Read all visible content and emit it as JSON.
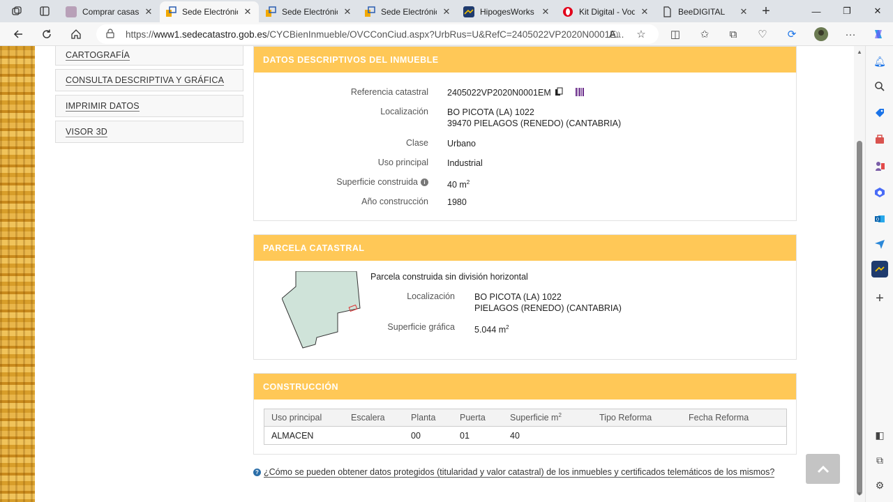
{
  "browser": {
    "tabs": [
      {
        "title": "Comprar casas e",
        "favicon": "idealista-icon"
      },
      {
        "title": "Sede Electrónica",
        "favicon": "catastro-icon"
      },
      {
        "title": "Sede Electrónica",
        "favicon": "catastro-icon"
      },
      {
        "title": "Sede Electrónica",
        "favicon": "catastro-icon"
      },
      {
        "title": "HipogesWorks -",
        "favicon": "hipoges-icon"
      },
      {
        "title": "Kit Digital - Vod",
        "favicon": "opera-icon"
      },
      {
        "title": "BeeDIGITAL",
        "favicon": "document-icon"
      }
    ],
    "address": {
      "prefix": "https://",
      "host": "www1.sedecatastro.gob.es",
      "path": "/CYCBienInmueble/OVCConCiud.aspx?UrbRus=U&RefC=2405022VP2020N0001E..."
    }
  },
  "leftnav": {
    "items": [
      "CARTOGRAFÍA",
      "CONSULTA DESCRIPTIVA Y GRÁFICA",
      "IMPRIMIR DATOS",
      "VISOR 3D"
    ]
  },
  "datos": {
    "title": "DATOS DESCRIPTIVOS DEL INMUEBLE",
    "ref_label": "Referencia catastral",
    "ref_value": "2405022VP2020N0001EM",
    "loc_label": "Localización",
    "loc_line1": "BO PICOTA (LA) 1022",
    "loc_line2": "39470 PIELAGOS (RENEDO) (CANTABRIA)",
    "clase_label": "Clase",
    "clase_value": "Urbano",
    "uso_label": "Uso principal",
    "uso_value": "Industrial",
    "sup_label": "Superficie construida",
    "sup_value": "40 m",
    "sup_exp": "2",
    "anio_label": "Año construcción",
    "anio_value": "1980"
  },
  "parcela": {
    "title": "PARCELA CATASTRAL",
    "subtitle": "Parcela construida sin división horizontal",
    "loc_label": "Localización",
    "loc_line1": "BO PICOTA (LA) 1022",
    "loc_line2": "PIELAGOS (RENEDO) (CANTABRIA)",
    "sup_label": "Superficie gráfica",
    "sup_value": "5.044 m",
    "sup_exp": "2"
  },
  "construccion": {
    "title": "CONSTRUCCIÓN",
    "headers": [
      "Uso principal",
      "Escalera",
      "Planta",
      "Puerta",
      "Superficie m",
      "Tipo Reforma",
      "Fecha Reforma"
    ],
    "sup_exp": "2",
    "rows": [
      [
        "ALMACEN",
        "",
        "00",
        "01",
        "40",
        "",
        ""
      ]
    ]
  },
  "help": {
    "text": "¿Cómo se pueden obtener datos protegidos (titularidad y valor catastral) de los inmuebles y certificados telemáticos de los mismos?"
  },
  "colors": {
    "panel_header": "#ffc857",
    "parcel_fill": "#cfe3d9"
  }
}
